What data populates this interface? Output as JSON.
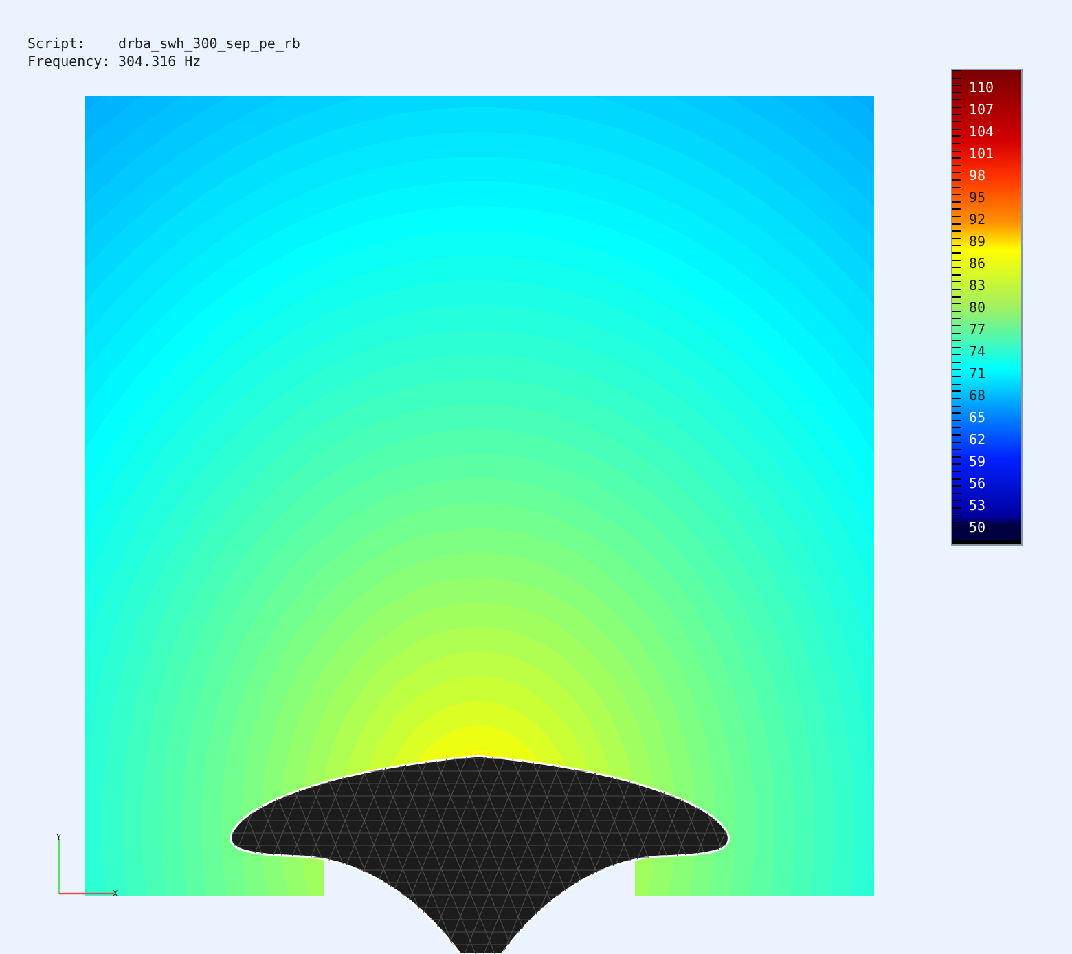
{
  "header": {
    "script_label": "Script:",
    "script_value": "drba_swh_300_sep_pe_rb",
    "frequency_label": "Frequency:",
    "frequency_value": "304.316 Hz"
  },
  "legend": {
    "labels": [
      "110",
      "107",
      "104",
      "101",
      "98",
      "95",
      "92",
      "89",
      "86",
      "83",
      "80",
      "77",
      "74",
      "71",
      "68",
      "65",
      "62",
      "59",
      "56",
      "53",
      "50"
    ]
  },
  "axes": {
    "x_label": "X",
    "y_label": "Y"
  }
}
